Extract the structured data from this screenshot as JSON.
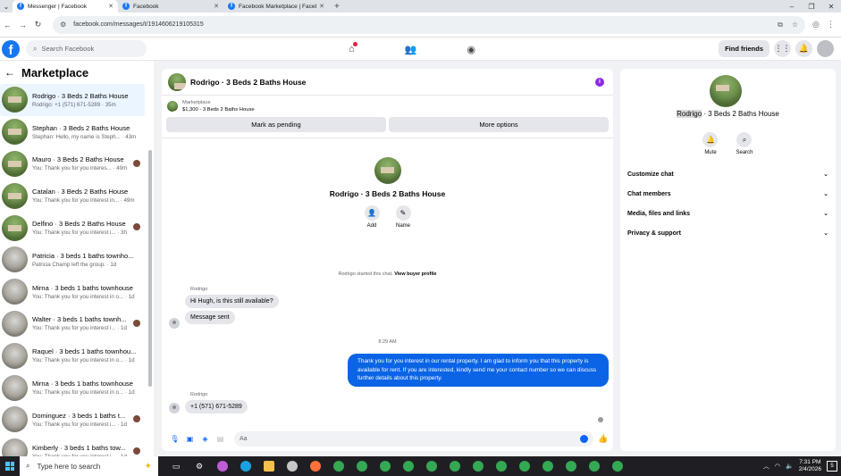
{
  "browser": {
    "tabs": [
      {
        "title": "Messenger | Facebook",
        "active": true
      },
      {
        "title": "Facebook",
        "active": false
      },
      {
        "title": "Facebook Marketplace | Facebo",
        "active": false
      }
    ],
    "url": "facebook.com/messages/t/1914606219105315"
  },
  "fb": {
    "logo": "f",
    "search_placeholder": "Search Facebook",
    "find_friends": "Find friends"
  },
  "sidebar": {
    "title": "Marketplace",
    "conversations": [
      {
        "name": "Rodrigo · 3 Beds 2 Baths House",
        "preview": "Rodrigo: +1 (571) 671-5289 · 35m",
        "thumb": "house",
        "selected": true,
        "seen": false
      },
      {
        "name": "Stephan · 3 Beds 2 Baths House",
        "preview": "Stephan: Hello, my name is Steph... · 43m",
        "thumb": "house",
        "selected": false,
        "seen": false
      },
      {
        "name": "Mauro · 3 Beds 2 Baths House",
        "preview": "You: Thank you for you interes... · 49m",
        "thumb": "house",
        "selected": false,
        "seen": true
      },
      {
        "name": "Catalan · 3 Beds 2 Baths House",
        "preview": "You: Thank you for you interest in... · 49m",
        "thumb": "house",
        "selected": false,
        "seen": false
      },
      {
        "name": "Delfino · 3 Beds 2 Baths House",
        "preview": "You: Thank you for you interest i... · 3h",
        "thumb": "house",
        "selected": false,
        "seen": true
      },
      {
        "name": "Patricia · 3 beds 1 baths townho...",
        "preview": "Patricia Champ left the group. · 1d",
        "thumb": "grey",
        "selected": false,
        "seen": false
      },
      {
        "name": "Mirna · 3 beds 1 baths townhouse",
        "preview": "You: Thank you for you interest in o... · 1d",
        "thumb": "grey",
        "selected": false,
        "seen": false
      },
      {
        "name": "Walter · 3 beds 1 baths townh...",
        "preview": "You: Thank you for you interest i... · 1d",
        "thumb": "grey",
        "selected": false,
        "seen": true
      },
      {
        "name": "Raquel · 3 beds 1 baths townhou...",
        "preview": "You: Thank you for you interest in o... · 1d",
        "thumb": "grey",
        "selected": false,
        "seen": false
      },
      {
        "name": "Mirna · 3 beds 1 baths townhouse",
        "preview": "You: Thank you for you interest in o... · 1d",
        "thumb": "grey",
        "selected": false,
        "seen": false
      },
      {
        "name": "Dominguez · 3 beds 1 baths t...",
        "preview": "You: Thank you for you interest i... · 1d",
        "thumb": "grey",
        "selected": false,
        "seen": true
      },
      {
        "name": "Kimberly · 3 beds 1 baths tow...",
        "preview": "You: Thank you for you interest i... · 1d",
        "thumb": "grey",
        "selected": false,
        "seen": true
      }
    ]
  },
  "chat": {
    "title": "Rodrigo · 3 Beds 2 Baths House",
    "marketplace_label": "Marketplace",
    "listing": "$1,300 - 3 Beds 2 Baths House",
    "mark_pending": "Mark as pending",
    "more_options": "More options",
    "profile_name": "Rodrigo · 3 Beds 2 Baths House",
    "add_label": "Add",
    "name_label": "Name",
    "system_note": "Rodrigo started this chat.",
    "view_buyer": "View buyer profile",
    "sender_1": "Rodrigo",
    "msg_1": "Hi Hugh, is this still available?",
    "msg_2": "Message sent",
    "timestamp": "8:29 AM",
    "outgoing": "Thank you for you interest in our rental property. I am glad to inform you that this property is available for rent. If you are interested, kindly send me your contact number so we can discuss further details about this property.",
    "sender_2": "Rodrigo",
    "msg_3": "+1 (571) 671-5289",
    "composer_placeholder": "Aa"
  },
  "info": {
    "name_highlight": "Rodrigo",
    "name_rest": " · 3 Beds 2 Baths House",
    "mute": "Mute",
    "search": "Search",
    "sections": [
      "Customize chat",
      "Chat members",
      "Media, files and links",
      "Privacy & support"
    ]
  },
  "taskbar": {
    "search_placeholder": "Type here to search",
    "time": "7:31 PM",
    "date": "2/4/2026",
    "notifications": "5"
  },
  "colors": {
    "accent": "#0866ff",
    "outgoing_bubble": "#0a64e5",
    "fb_blue": "#1877f2"
  }
}
